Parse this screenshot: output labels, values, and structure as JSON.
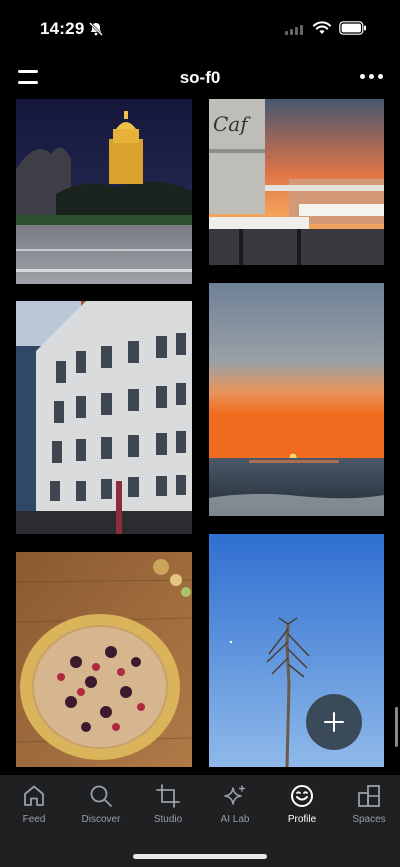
{
  "status_bar": {
    "time": "14:29"
  },
  "header": {
    "title": "so-f0"
  },
  "photos": [
    {
      "icon": "city-hall-night-photo"
    },
    {
      "icon": "pier-sunset-photo"
    },
    {
      "icon": "ornate-building-photo"
    },
    {
      "icon": "ocean-sunset-photo"
    },
    {
      "icon": "berry-tart-photo"
    },
    {
      "icon": "agave-sky-photo"
    }
  ],
  "fab": {
    "icon": "plus-icon"
  },
  "tabs": [
    {
      "label": "Feed",
      "icon": "home-icon"
    },
    {
      "label": "Discover",
      "icon": "search-icon"
    },
    {
      "label": "Studio",
      "icon": "crop-icon"
    },
    {
      "label": "AI Lab",
      "icon": "sparkle-icon"
    },
    {
      "label": "Profile",
      "icon": "smiley-icon",
      "active": true
    },
    {
      "label": "Spaces",
      "icon": "spaces-icon"
    }
  ],
  "colors": {
    "tab_bar_bg": "#1e2022",
    "fab_bg": "#3b4a58",
    "tab_inactive": "#9a9fa6"
  }
}
